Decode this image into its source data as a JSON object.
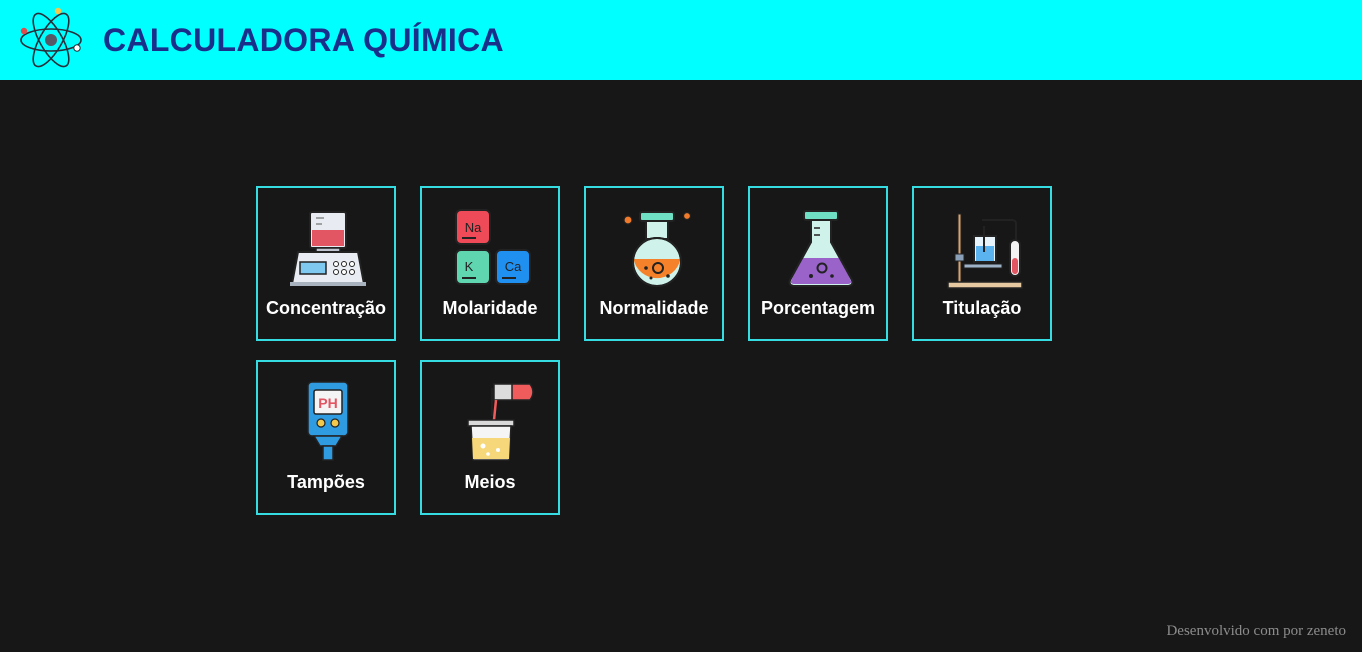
{
  "app": {
    "title": "CALCULADORA QUÍMICA",
    "logo_icon": "atom-icon"
  },
  "menu": {
    "items": [
      {
        "label": "Concentração",
        "icon": "lab-scale-beaker-icon"
      },
      {
        "label": "Molaridade",
        "icon": "periodic-elements-icon"
      },
      {
        "label": "Normalidade",
        "icon": "round-flask-icon"
      },
      {
        "label": "Porcentagem",
        "icon": "erlenmeyer-flask-icon"
      },
      {
        "label": "Titulação",
        "icon": "titration-setup-icon"
      },
      {
        "label": "Tampões",
        "icon": "ph-meter-icon"
      },
      {
        "label": "Meios",
        "icon": "pouring-test-tube-icon"
      }
    ]
  },
  "footer": {
    "text": "Desenvolvido com por zeneto"
  },
  "colors": {
    "header_bg": "#00ffff",
    "title": "#1a2f8a",
    "page_bg": "#171717",
    "card_border": "#35dde2",
    "card_text": "#ffffff",
    "footer_text": "#8c8c8c"
  }
}
